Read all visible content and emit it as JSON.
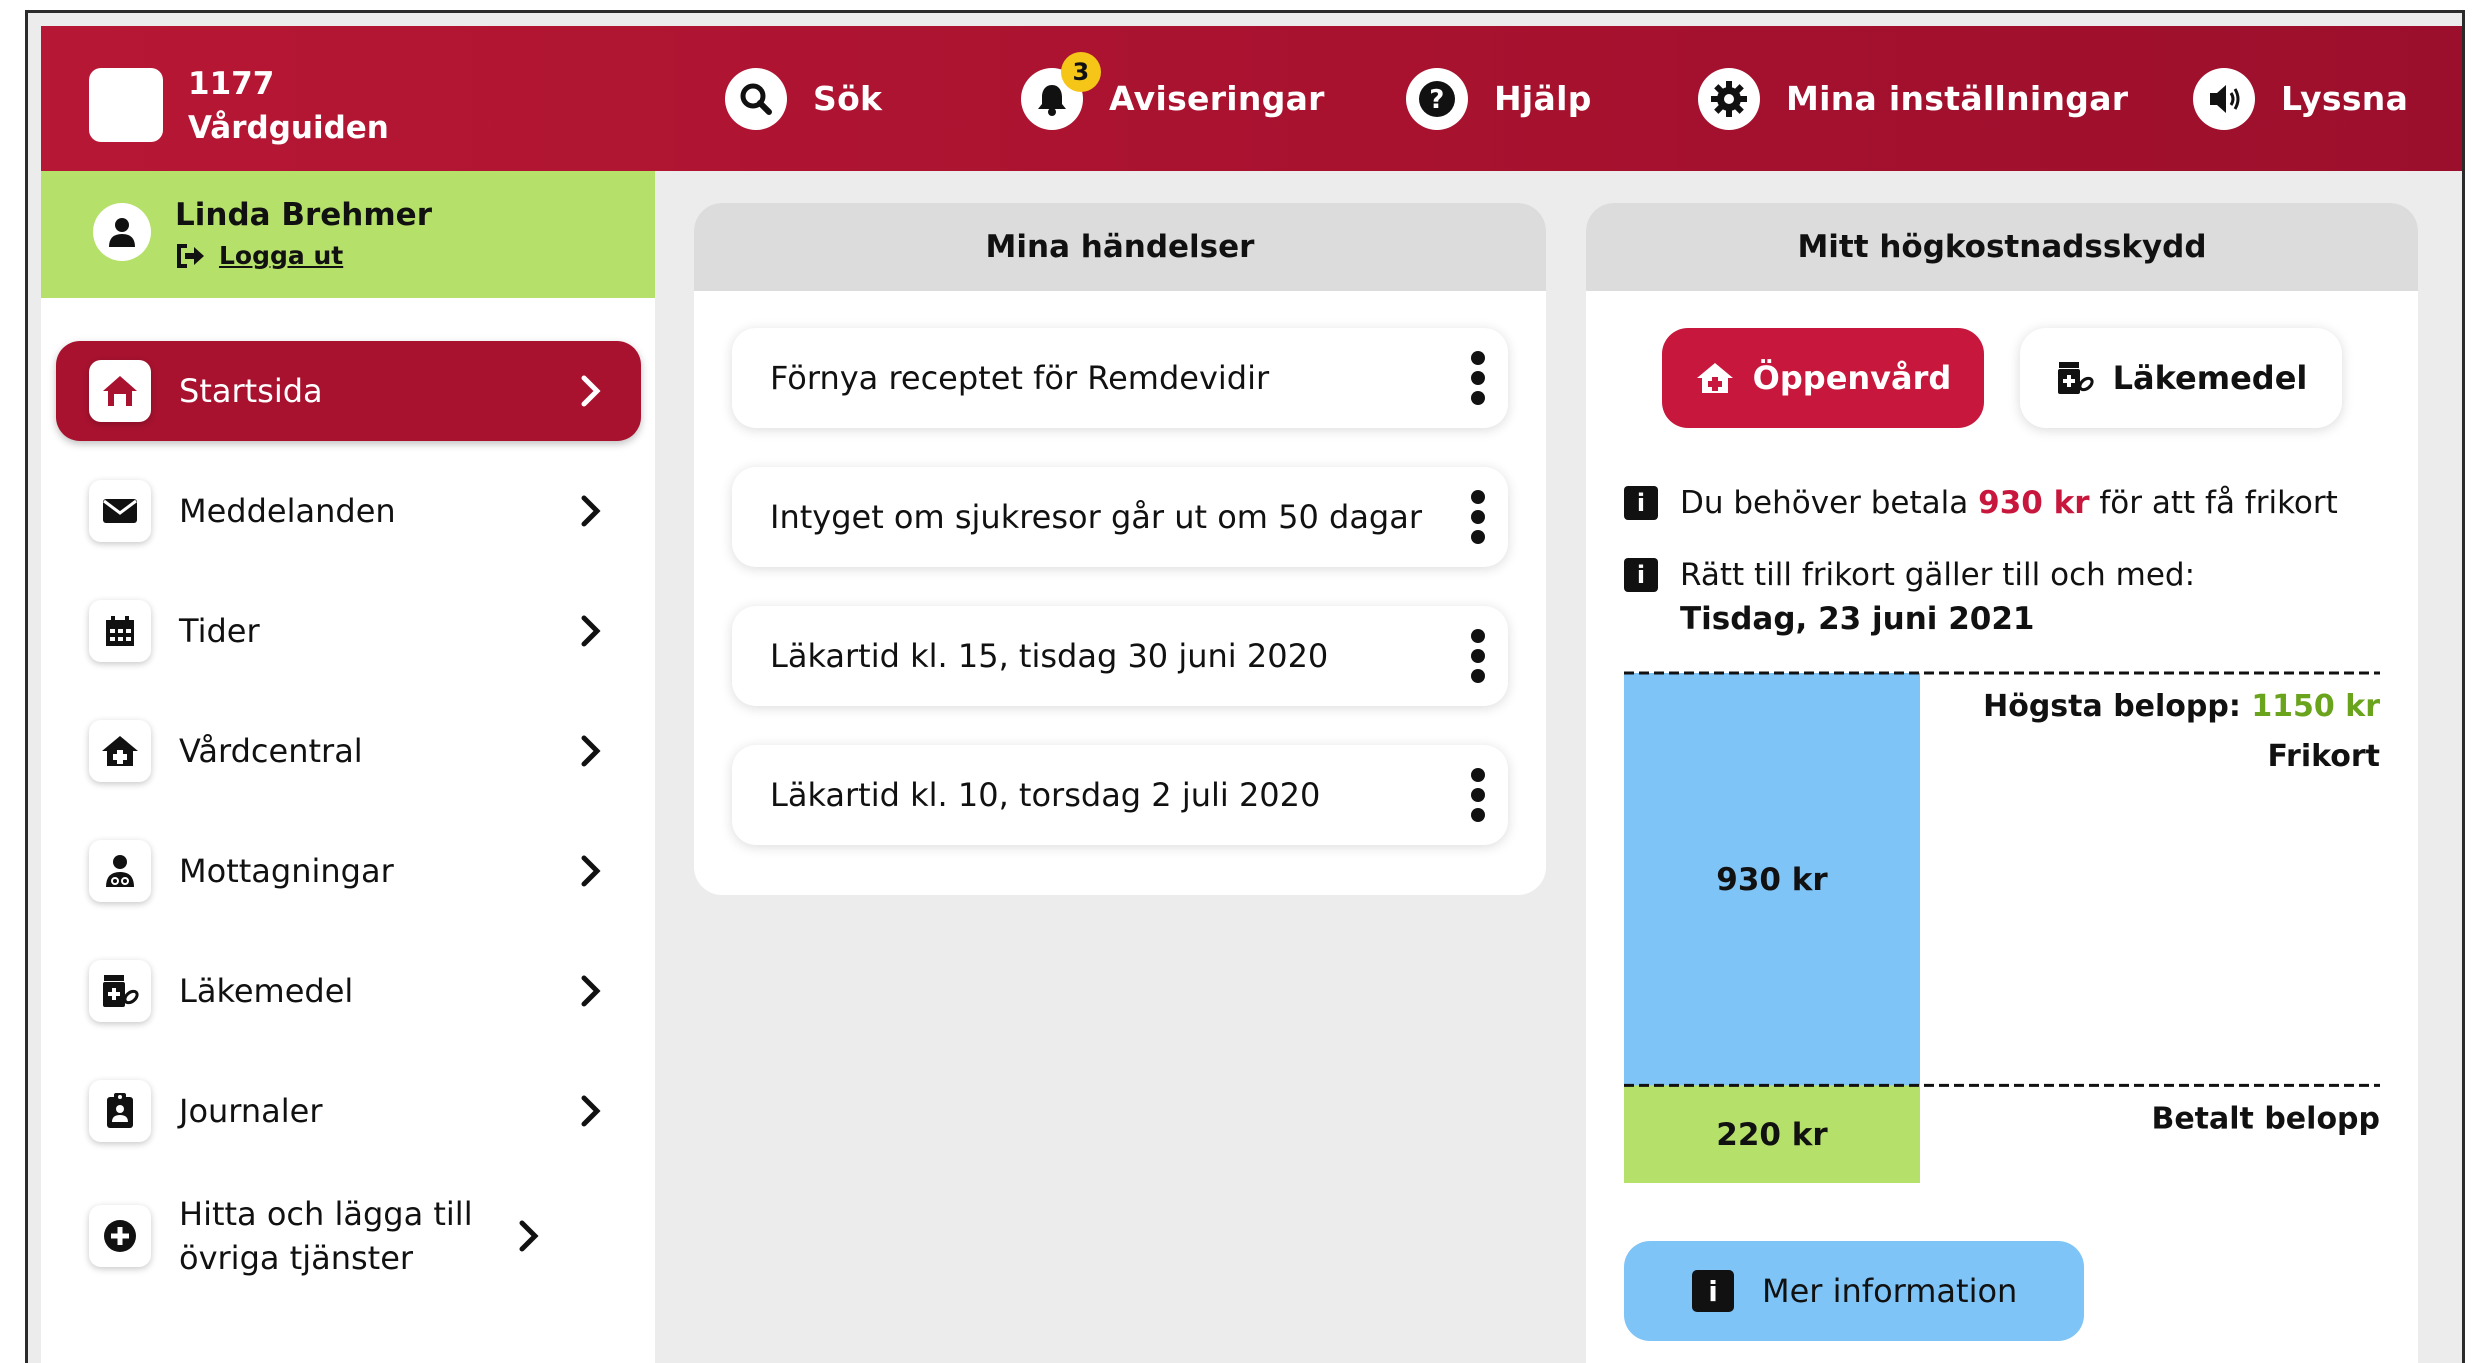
{
  "header": {
    "brand_line1": "1177",
    "brand_line2": "Vårdguiden",
    "nav": {
      "search": "Sök",
      "notifications": "Aviseringar",
      "notifications_count": "3",
      "help": "Hjälp",
      "settings": "Mina inställningar",
      "listen": "Lyssna"
    }
  },
  "user": {
    "name": "Linda Brehmer",
    "logout": "Logga ut"
  },
  "sidebar": {
    "items": [
      {
        "label": "Startsida",
        "icon": "home-icon"
      },
      {
        "label": "Meddelanden",
        "icon": "envelope-icon"
      },
      {
        "label": "Tider",
        "icon": "calendar-icon"
      },
      {
        "label": "Vårdcentral",
        "icon": "clinic-icon"
      },
      {
        "label": "Mottagningar",
        "icon": "doctor-icon"
      },
      {
        "label": "Läkemedel",
        "icon": "medicine-icon"
      },
      {
        "label": "Journaler",
        "icon": "clipboard-icon"
      },
      {
        "label": "Hitta och lägga till övriga tjänster",
        "icon": "plus-circle-icon"
      }
    ]
  },
  "events": {
    "title": "Mina händelser",
    "items": [
      "Förnya receptet för Remdevidir",
      "Intyget om sjukresor går ut om 50 dagar",
      "Läkartid kl. 15, tisdag 30 juni 2020",
      "Läkartid kl. 10, torsdag 2 juli 2020"
    ]
  },
  "cost": {
    "title": "Mitt högkostnadsskydd",
    "tab_open_care": "Öppenvård",
    "tab_medicine": "Läkemedel",
    "info1_pre": "Du behöver betala",
    "info1_amount": "930 kr",
    "info1_post": "för att få frikort",
    "info2_line1": "Rätt till frikort gäller till och med:",
    "info2_line2": "Tisdag, 23 juni 2021",
    "max_label": "Högsta belopp:",
    "max_amount": "1150 kr",
    "frikort": "Frikort",
    "remaining_label": "930 kr",
    "paid_label": "220 kr",
    "paid_caption": "Betalt belopp",
    "more_info": "Mer information",
    "remaining_value": 930,
    "paid_value": 220,
    "max_value": 1150,
    "color_remaining": "#7fc4f7",
    "color_paid": "#b5e06a"
  }
}
